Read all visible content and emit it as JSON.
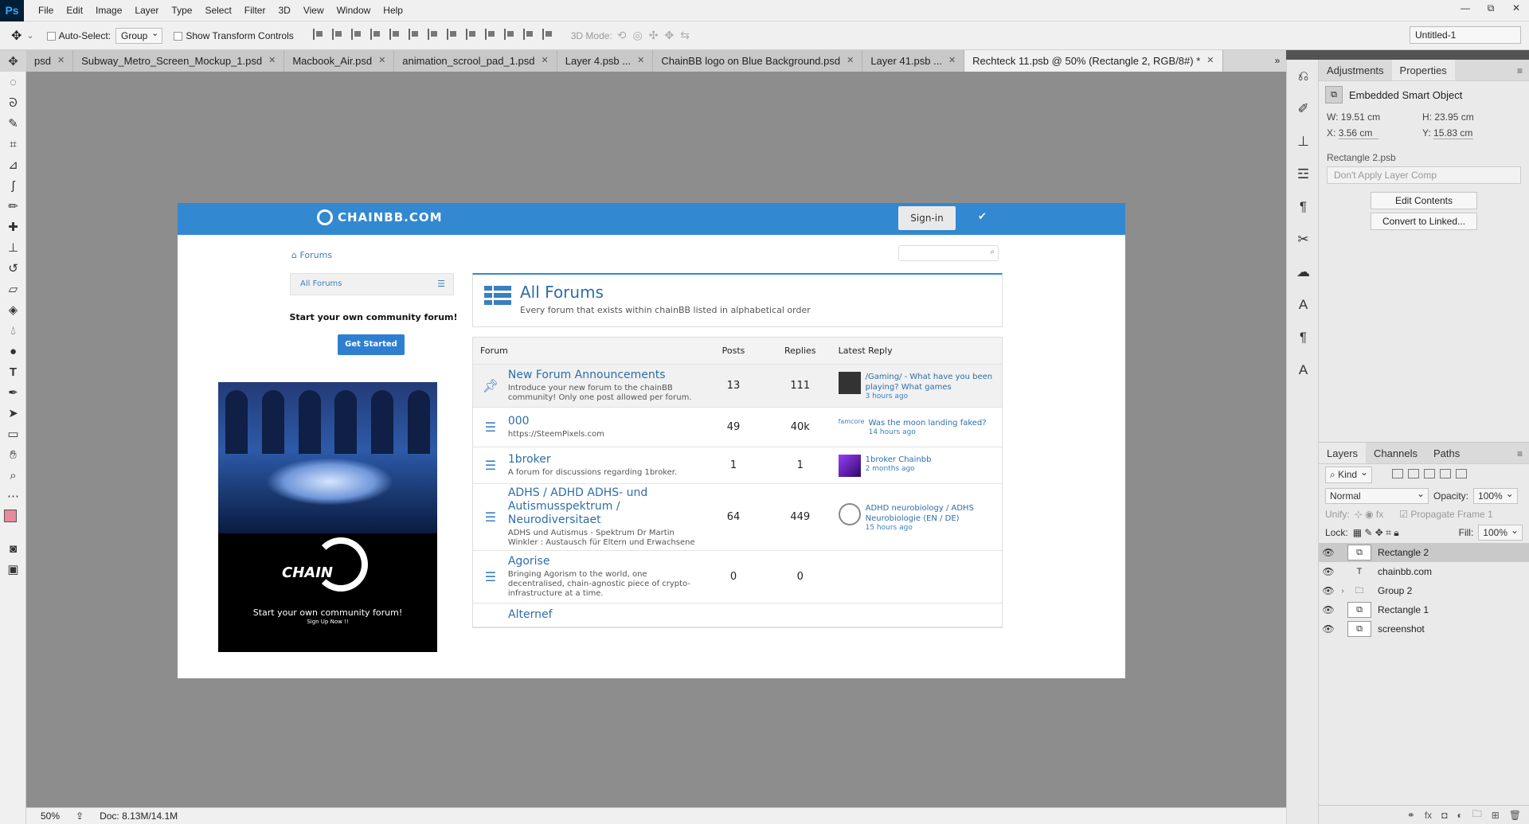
{
  "app": {
    "logo": "Ps",
    "menu": [
      "File",
      "Edit",
      "Image",
      "Layer",
      "Type",
      "Select",
      "Filter",
      "3D",
      "View",
      "Window",
      "Help"
    ],
    "window_controls": [
      "—",
      "⧉",
      "✕"
    ]
  },
  "options_bar": {
    "auto_select_label": "Auto-Select:",
    "auto_select_value": "Group",
    "show_transform_label": "Show Transform Controls",
    "mode_3d_label": "3D Mode:",
    "document_select": "Untitled-1"
  },
  "tabs": [
    {
      "label": "psd",
      "active": false
    },
    {
      "label": "Subway_Metro_Screen_Mockup_1.psd",
      "active": false
    },
    {
      "label": "Macbook_Air.psd",
      "active": false
    },
    {
      "label": "animation_scrool_pad_1.psd",
      "active": false
    },
    {
      "label": "Layer 4.psb ...",
      "active": false
    },
    {
      "label": "ChainBB logo on Blue Background.psd",
      "active": false
    },
    {
      "label": "Layer 41.psb ...",
      "active": false
    },
    {
      "label": "Rechteck 11.psb @ 50% (Rectangle 2, RGB/8#) *",
      "active": true
    }
  ],
  "tabs_overflow": "»",
  "tools": [
    "move",
    "marquee",
    "lasso",
    "quick-select",
    "crop",
    "eyedropper",
    "brush",
    "pencil",
    "healing",
    "clone",
    "history-brush",
    "eraser",
    "paint-bucket",
    "blur",
    "dodge",
    "pen",
    "type",
    "path-select",
    "rectangle",
    "hand",
    "zoom",
    "more",
    "swap",
    "colors",
    "quickmask",
    "screen-mode"
  ],
  "status": {
    "zoom": "50%",
    "doc": "Doc: 8.13M/14.1M"
  },
  "properties": {
    "tabs": [
      "Adjustments",
      "Properties"
    ],
    "active_tab": "Properties",
    "type": "Embedded Smart Object",
    "w_label": "W:",
    "w_value": "19.51 cm",
    "h_label": "H:",
    "h_value": "23.95 cm",
    "x_label": "X:",
    "x_value": "3.56 cm",
    "y_label": "Y:",
    "y_value": "15.83 cm",
    "file": "Rectangle 2.psb",
    "layer_comp": "Don't Apply Layer Comp",
    "edit_contents": "Edit Contents",
    "convert": "Convert to Linked..."
  },
  "layers_panel": {
    "tabs": [
      "Layers",
      "Channels",
      "Paths"
    ],
    "kind": "Kind",
    "blend": "Normal",
    "opacity_label": "Opacity:",
    "opacity": "100%",
    "unify_label": "Unify:",
    "propagate": "Propagate Frame 1",
    "lock_label": "Lock:",
    "fill_label": "Fill:",
    "fill": "100%",
    "layers": [
      {
        "name": "Rectangle 2",
        "kind": "smart",
        "selected": true,
        "group": false
      },
      {
        "name": "chainbb.com",
        "kind": "text",
        "selected": false,
        "group": false
      },
      {
        "name": "Group 2",
        "kind": "folder",
        "selected": false,
        "group": true
      },
      {
        "name": "Rectangle 1",
        "kind": "smart",
        "selected": false,
        "group": false
      },
      {
        "name": "screenshot",
        "kind": "smart",
        "selected": false,
        "group": false
      }
    ]
  },
  "site": {
    "brand": "CHAINBB.COM",
    "signin": "Sign-in",
    "breadcrumb": "Forums",
    "sidebar_all": "All Forums",
    "own_forum": "Start your own community forum!",
    "get_started": "Get Started",
    "banner_chain": "CHAIN",
    "banner_text": "Start your own community forum!",
    "banner_sub": "Sign Up Now !!",
    "title": "All Forums",
    "subtitle": "Every forum that exists within chainBB listed in alphabetical order",
    "columns": [
      "Forum",
      "Posts",
      "Replies",
      "Latest Reply"
    ],
    "forums": [
      {
        "name": "New Forum Announcements",
        "desc": "Introduce your new forum to the chainBB community! Only one post allowed per forum.",
        "posts": "13",
        "replies": "111",
        "latest": "/Gaming/ - What have you been playing? What games",
        "ago": "3 hours ago",
        "pinned": true,
        "avatar_text": ""
      },
      {
        "name": "000",
        "desc": "https://SteemPixels.com",
        "posts": "49",
        "replies": "40k",
        "latest": "Was the moon landing faked?",
        "ago": "14 hours ago",
        "pinned": false,
        "avatar_text": "famcore"
      },
      {
        "name": "1broker",
        "desc": "A forum for discussions regarding 1broker.",
        "posts": "1",
        "replies": "1",
        "latest": "1broker Chainbb",
        "ago": "2 months ago",
        "pinned": false,
        "avatar_text": ""
      },
      {
        "name": "ADHS / ADHD ADHS- und Autismusspektrum / Neurodiversitaet",
        "desc": "ADHS und Autismus - Spektrum Dr Martin Winkler : Austausch für Eltern und Erwachsene",
        "posts": "64",
        "replies": "449",
        "latest": "ADHD neurobiology / ADHS Neurobiologie (EN / DE)",
        "ago": "15 hours ago",
        "pinned": false,
        "avatar_text": ""
      },
      {
        "name": "Agorise",
        "desc": "Bringing Agorism to the world, one decentralised, chain-agnostic piece of crypto-infrastructure at a time.",
        "posts": "0",
        "replies": "0",
        "latest": "",
        "ago": "",
        "pinned": false,
        "avatar_text": ""
      },
      {
        "name": "Alternef",
        "desc": "",
        "posts": "",
        "replies": "",
        "latest": "",
        "ago": "",
        "pinned": false,
        "avatar_text": ""
      }
    ]
  }
}
